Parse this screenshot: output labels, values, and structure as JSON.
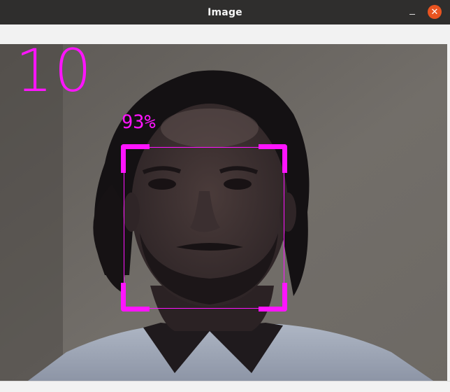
{
  "window": {
    "title": "Image",
    "close_glyph": "✕"
  },
  "overlay": {
    "frame_counter": "10",
    "confidence_label": "93%",
    "confidence_value": 0.93,
    "accent_color": "#ff14ff"
  },
  "icons": {
    "minimize": "minimize-icon",
    "close": "close-icon"
  },
  "colors": {
    "titlebar": "#2f2e2d",
    "close_button": "#e95420",
    "window_bg": "#f2f2f2"
  }
}
